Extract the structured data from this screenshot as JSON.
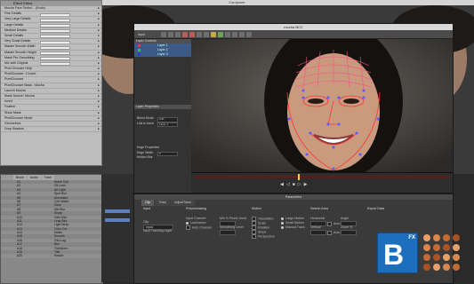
{
  "host": {
    "title": "Composer"
  },
  "effect_editor": {
    "title": "Effect Editor",
    "rows": [
      "Mocha Face Techni... (Kodo)",
      "Fine Details",
      "Very Large Details",
      "Large Details",
      "Medium Details",
      "Small Details",
      "Very Small Details",
      "Master Smooth Width",
      "Master Smooth Height",
      "Mask Pre-Smoothing",
      "Mix with Original",
      "Pixel Chooser Help",
      "PixelChooser: 1 Invert",
      "PixelChooser",
      "PixelChooser Mask : Mocha",
      "Launch Mocha",
      "Mask Source: Mocha",
      "Invert",
      "Feather",
      "Show Mask",
      "PixelChooser Mode",
      "Geometrics",
      "Drop Shadow"
    ]
  },
  "mocha": {
    "title": "mocha BCC",
    "layer_controls": "Layer Controls",
    "layers": [
      "Layer 1",
      "Layer 2",
      "Layer 3"
    ],
    "layer_properties": "Layer Properties",
    "props": [
      {
        "label": "Blend Mode",
        "value": "Add"
      },
      {
        "label": "Link to track",
        "value": "Layer 1"
      },
      {
        "label": "Edge Properties",
        "value": ""
      },
      {
        "label": "Edge Width",
        "value": "0"
      },
      {
        "label": "Motion Blur",
        "value": ""
      }
    ],
    "input_label": "Input"
  },
  "params": {
    "title": "Parameters",
    "tabs": [
      "Clip",
      "Track",
      "AdjustTrack"
    ],
    "input": {
      "head": "Input",
      "clip_label": "Clip",
      "clip_value": "Input",
      "layer_value": "Input Tracking Layer"
    },
    "preprocessing": {
      "head": "Preprocessing",
      "items": [
        "Input Channel",
        "Luminance",
        "Auto Channel"
      ],
      "min_pixels": "Min % Pixels Used",
      "smoothing": "Smoothing Level"
    },
    "motion": {
      "head": "Motion",
      "items": [
        "Translation",
        "Scale",
        "Rotation",
        "Shear",
        "Perspective"
      ],
      "large": "Large Motion",
      "small": "Small Motion",
      "manual": "Manual Track"
    },
    "search_area": {
      "head": "Search Area",
      "horizontal": "Horizontal",
      "vertical": "Vertical",
      "auto": "Auto",
      "angle": "Angle",
      "zoom": "Zoom %"
    },
    "export_data": {
      "head": "Export Data"
    }
  },
  "bin": {
    "tabs": [
      "Brush",
      "Audio",
      "Track"
    ],
    "rows": [
      [
        "A1",
        "Noise Coll"
      ],
      [
        "A2",
        "Oil Lean"
      ],
      [
        "A3",
        "Art Light"
      ],
      [
        "A4",
        "Spot Blur"
      ],
      [
        "A5",
        "Aircontact"
      ],
      [
        "A6",
        "Colr Match"
      ],
      [
        "A7",
        "Glow"
      ],
      [
        "A8",
        "Mix Blur"
      ],
      [
        "A9",
        "Sharp"
      ],
      [
        "A10",
        "Halo Mat"
      ],
      [
        "A11",
        "Leap Blur"
      ],
      [
        "A12",
        "Light Wrap"
      ],
      [
        "A13",
        "Color Cor"
      ],
      [
        "A14",
        "Match"
      ],
      [
        "A15",
        "Smooth"
      ],
      [
        "A16",
        "Film Lag"
      ],
      [
        "A17",
        "Blur"
      ],
      [
        "A18",
        "Transform"
      ],
      [
        "A19",
        "Title"
      ],
      [
        "A20",
        "Resize"
      ]
    ]
  },
  "logo": {
    "letter": "B",
    "fx": "FX"
  },
  "colors": {
    "accent": "#1d6fbd",
    "mesh": "#ff4d8d",
    "track_point": "#5a5bff"
  }
}
